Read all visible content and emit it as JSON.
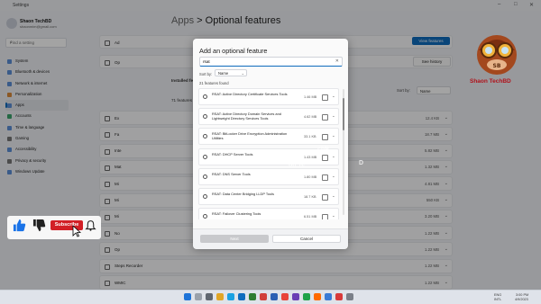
{
  "window": {
    "title": "Settings"
  },
  "user": {
    "name": "Shaon TechBD",
    "email": "shaonmim@gmail.com"
  },
  "search": {
    "placeholder": "Find a setting"
  },
  "nav": [
    "System",
    "Bluetooth & devices",
    "Network & internet",
    "Personalization",
    "Apps",
    "Accounts",
    "Time & language",
    "Gaming",
    "Accessibility",
    "Privacy & security",
    "Windows Update"
  ],
  "nav_active": "Apps",
  "breadcrumb": {
    "parent": "Apps",
    "sep": ">",
    "current": "Optional features"
  },
  "background": {
    "add_label": "Ad",
    "view_features": "View features",
    "history_label": "Op",
    "see_history": "See history",
    "installed_label": "Installed fe",
    "installed_count": "71 features fo",
    "sort_by": "Sort by:",
    "sort_value": "Name",
    "items": [
      {
        "label": "Ex",
        "size": "12.4 KB"
      },
      {
        "label": "Fa",
        "size": "18.7 MB"
      },
      {
        "label": "Inte",
        "size": "5.82 MB"
      },
      {
        "label": "Mat",
        "size": "1.32 MB"
      },
      {
        "label": "Mi",
        "size": "4.81 MB"
      },
      {
        "label": "Mi",
        "size": "550 KB"
      },
      {
        "label": "Mi",
        "size": "3.20 MB"
      },
      {
        "label": "No",
        "size": "1.22 MB"
      },
      {
        "label": "Op",
        "size": "1.22 MB"
      },
      {
        "label": "Steps Recorder",
        "size": "1.22 MB"
      },
      {
        "label": "WMIC",
        "size": "1.22 MB"
      }
    ]
  },
  "dialog": {
    "title": "Add an optional feature",
    "search_value": "rsat",
    "sort_label": "Sort by:",
    "sort_value": "Name",
    "count": "21 features found",
    "features": [
      {
        "name": "RSAT: Active Directory Certificate Services Tools",
        "size": "1.46 MB"
      },
      {
        "name": "RSAT: Active Directory Domain Services and Lightweight Directory Services Tools",
        "size": "4.62 MB"
      },
      {
        "name": "RSAT: BitLocker Drive Encryption Administration Utilities",
        "size": "33.1 KB"
      },
      {
        "name": "RSAT: DHCP Server Tools",
        "size": "1.43 MB"
      },
      {
        "name": "RSAT: DNS Server Tools",
        "size": "1.80 MB"
      },
      {
        "name": "RSAT: Data Center Bridging LLDP Tools",
        "size": "18.7 KB"
      },
      {
        "name": "RSAT: Failover Clustering Tools",
        "size": "6.51 MB"
      }
    ],
    "next": "Next",
    "cancel": "Cancel"
  },
  "branding": {
    "channel": "Shaon TechBD",
    "watermark_1": "Sha",
    "watermark_2": "on Te",
    "watermark_3": "chB",
    "watermark_4": "D"
  },
  "widget": {
    "subscribe": "Subscribe"
  },
  "tray": {
    "lang_1": "ENG",
    "lang_2": "INTL",
    "time": "3:00 PM",
    "date": "4/9/2023"
  },
  "colors": {
    "accent": "#0f6cbd",
    "subscribe": "#d21f26",
    "brand_text": "#b0121b"
  }
}
